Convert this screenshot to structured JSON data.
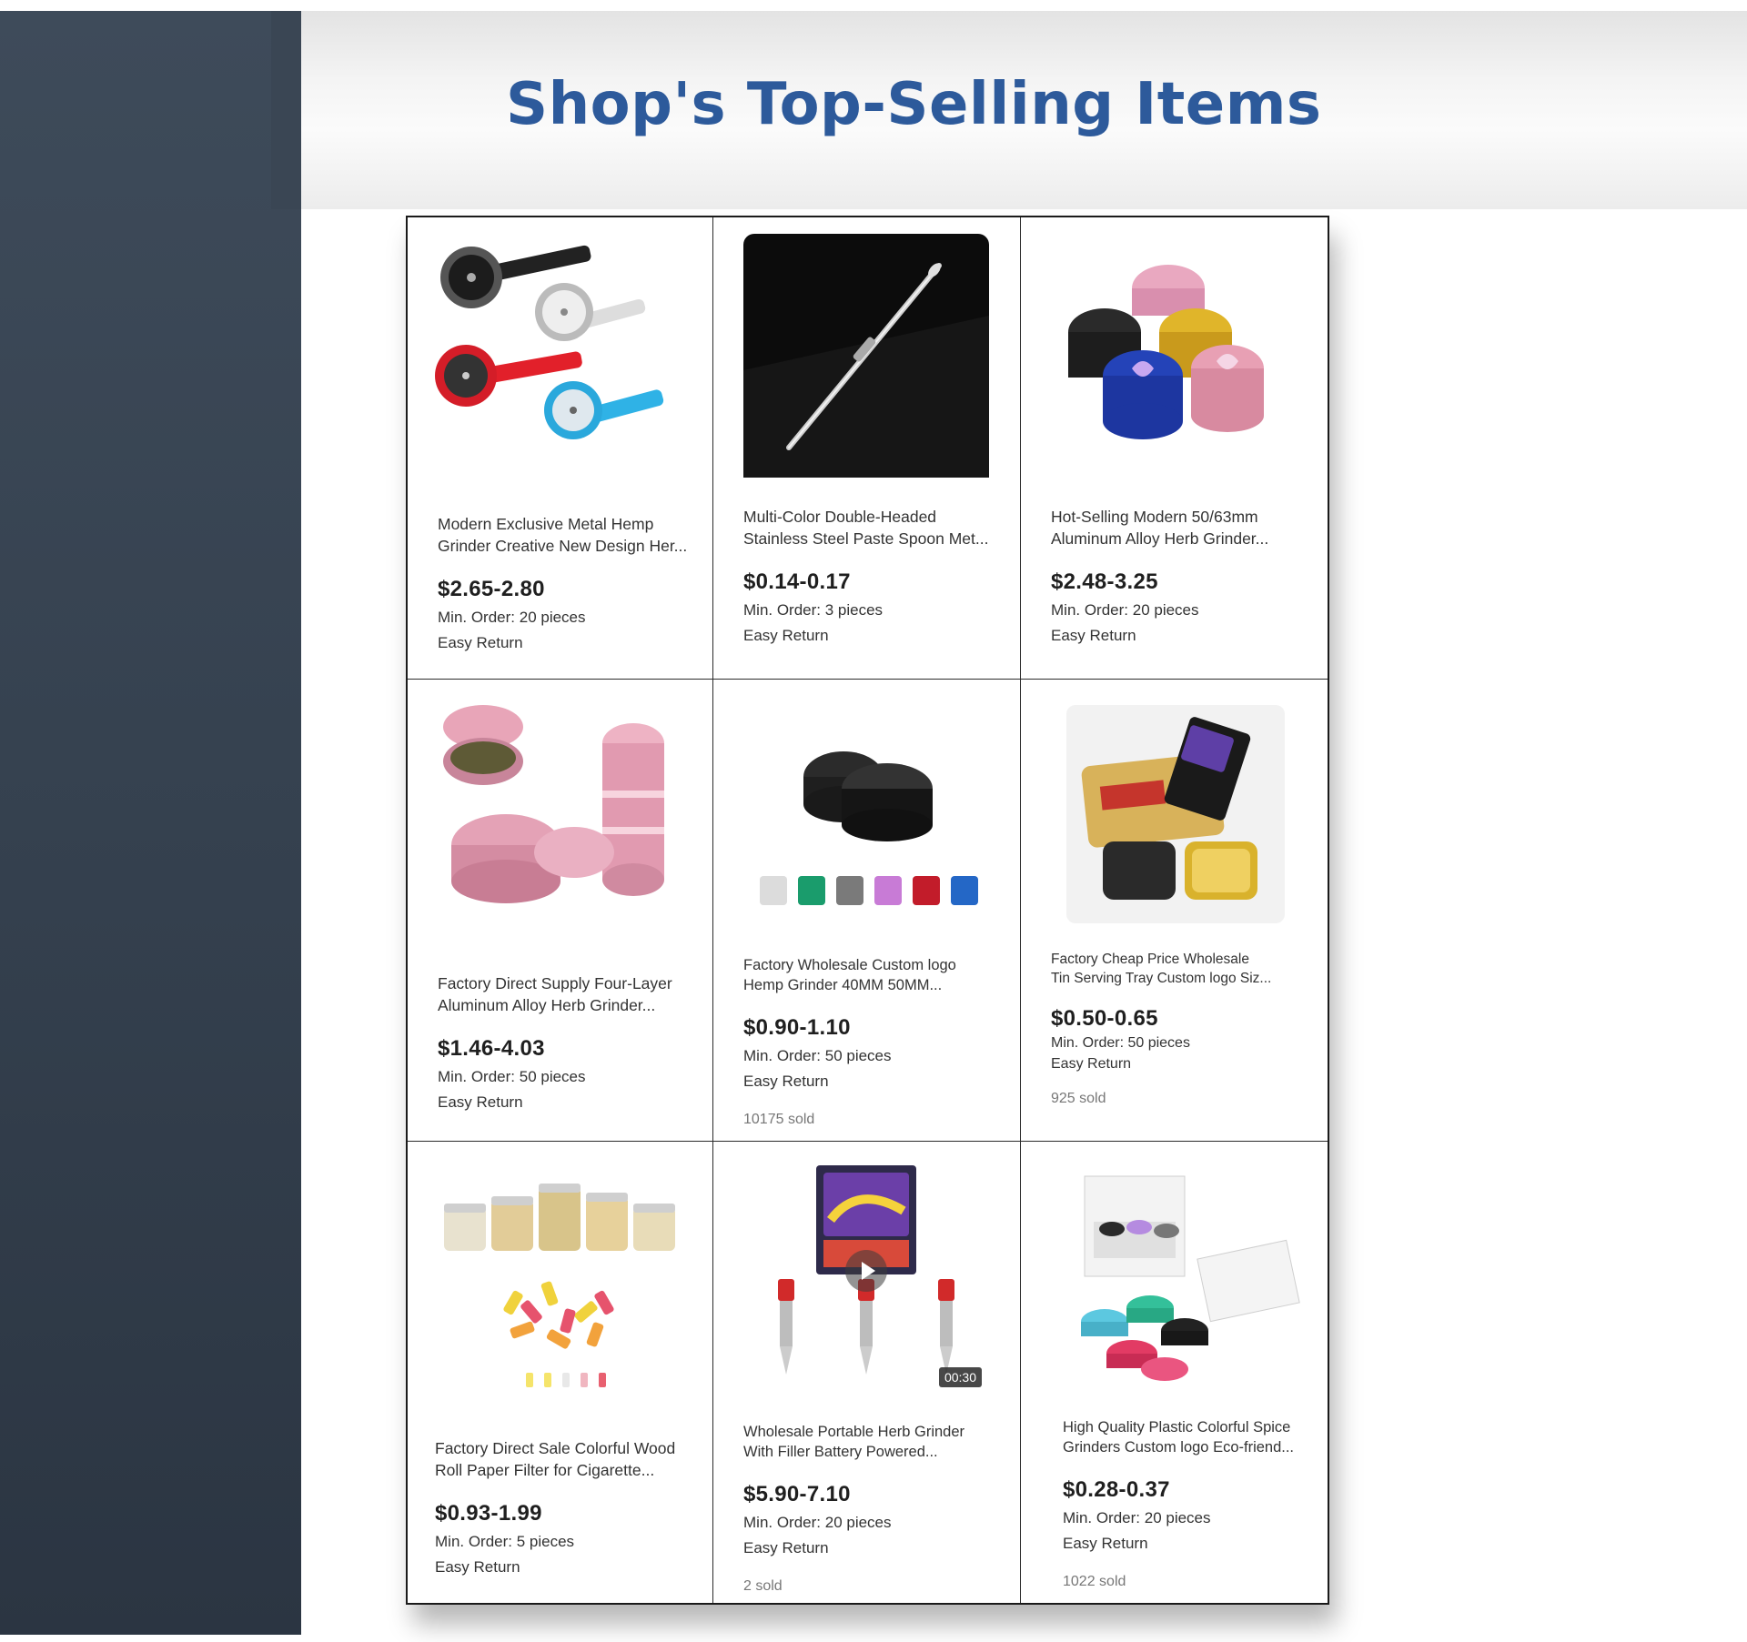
{
  "header": {
    "title": "Shop's Top-Selling Items"
  },
  "products": [
    {
      "line1": "Modern Exclusive Metal Hemp",
      "line2": "Grinder Creative New Design Her...",
      "price": "$2.65-2.80",
      "min_order": "Min. Order: 20 pieces",
      "return": "Easy Return",
      "sold": "",
      "image_icon": "watch-grinder-image"
    },
    {
      "line1": "Multi-Color Double-Headed",
      "line2": "Stainless Steel Paste Spoon Met...",
      "price": "$0.14-0.17",
      "min_order": "Min. Order: 3 pieces",
      "return": "Easy Return",
      "sold": "",
      "image_icon": "spoon-tool-image"
    },
    {
      "line1": "Hot-Selling Modern 50/63mm",
      "line2": "Aluminum Alloy Herb Grinder...",
      "price": "$2.48-3.25",
      "min_order": "Min. Order: 20 pieces",
      "return": "Easy Return",
      "sold": "",
      "image_icon": "jeweled-grinder-image"
    },
    {
      "line1": "Factory Direct Supply Four-Layer",
      "line2": "Aluminum Alloy Herb Grinder...",
      "price": "$1.46-4.03",
      "min_order": "Min. Order: 50 pieces",
      "return": "Easy Return",
      "sold": "",
      "image_icon": "pink-grinder-image"
    },
    {
      "line1": "Factory Wholesale Custom logo",
      "line2": "Hemp Grinder 40MM 50MM...",
      "price": "$0.90-1.10",
      "min_order": "Min. Order: 50 pieces",
      "return": "Easy Return",
      "sold": "10175 sold",
      "image_icon": "black-grinder-image"
    },
    {
      "line1": "Factory Cheap Price Wholesale",
      "line2": "Tin Serving Tray Custom logo Siz...",
      "price": "$0.50-0.65",
      "min_order": "Min. Order: 50 pieces",
      "return": "Easy Return",
      "sold": "925 sold",
      "image_icon": "tin-tray-image"
    },
    {
      "line1": "Factory Direct Sale Colorful Wood",
      "line2": "Roll Paper Filter for Cigarette...",
      "price": "$0.93-1.99",
      "min_order": "Min. Order: 5 pieces",
      "return": "Easy Return",
      "sold": "",
      "image_icon": "paper-filter-jars-image"
    },
    {
      "line1": "Wholesale Portable Herb Grinder",
      "line2": "With Filler Battery Powered...",
      "price": "$5.90-7.10",
      "min_order": "Min. Order: 20 pieces",
      "return": "Easy Return",
      "sold": "2 sold",
      "image_icon": "electric-grinder-video",
      "video_time": "00:30"
    },
    {
      "line1": "High Quality Plastic Colorful Spice",
      "line2": "Grinders Custom logo Eco-friend...",
      "price": "$0.28-0.37",
      "min_order": "Min. Order: 20 pieces",
      "return": "Easy Return",
      "sold": "1022 sold",
      "image_icon": "plastic-grinders-image"
    }
  ]
}
